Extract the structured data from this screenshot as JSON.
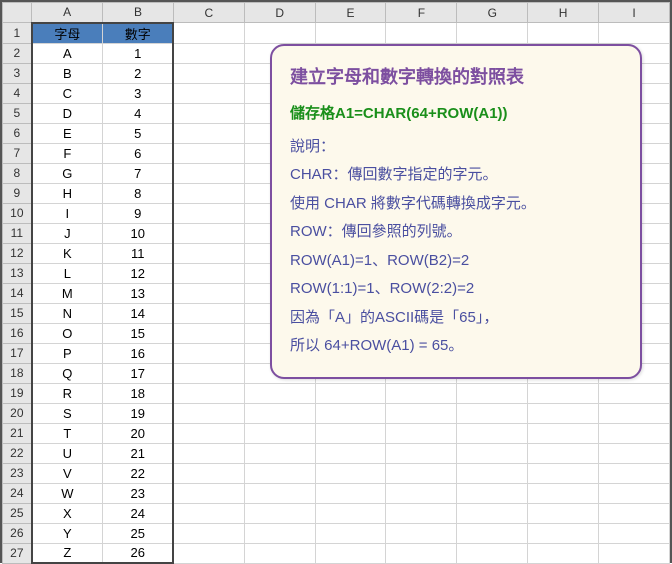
{
  "columns": [
    "A",
    "B",
    "C",
    "D",
    "E",
    "F",
    "G",
    "H",
    "I"
  ],
  "headers": {
    "A": "字母",
    "B": "數字"
  },
  "rows": [
    {
      "A": "A",
      "B": "1"
    },
    {
      "A": "B",
      "B": "2"
    },
    {
      "A": "C",
      "B": "3"
    },
    {
      "A": "D",
      "B": "4"
    },
    {
      "A": "E",
      "B": "5"
    },
    {
      "A": "F",
      "B": "6"
    },
    {
      "A": "G",
      "B": "7"
    },
    {
      "A": "H",
      "B": "8"
    },
    {
      "A": "I",
      "B": "9"
    },
    {
      "A": "J",
      "B": "10"
    },
    {
      "A": "K",
      "B": "11"
    },
    {
      "A": "L",
      "B": "12"
    },
    {
      "A": "M",
      "B": "13"
    },
    {
      "A": "N",
      "B": "14"
    },
    {
      "A": "O",
      "B": "15"
    },
    {
      "A": "P",
      "B": "16"
    },
    {
      "A": "Q",
      "B": "17"
    },
    {
      "A": "R",
      "B": "18"
    },
    {
      "A": "S",
      "B": "19"
    },
    {
      "A": "T",
      "B": "20"
    },
    {
      "A": "U",
      "B": "21"
    },
    {
      "A": "V",
      "B": "22"
    },
    {
      "A": "W",
      "B": "23"
    },
    {
      "A": "X",
      "B": "24"
    },
    {
      "A": "Y",
      "B": "25"
    },
    {
      "A": "Z",
      "B": "26"
    }
  ],
  "callout": {
    "title": "建立字母和數字轉換的對照表",
    "formula": "儲存格A1=CHAR(64+ROW(A1))",
    "lines": [
      "說明：",
      "CHAR：傳回數字指定的字元。",
      "使用 CHAR 將數字代碼轉換成字元。",
      "ROW：傳回參照的列號。",
      "ROW(A1)=1、ROW(B2)=2",
      "ROW(1:1)=1、ROW(2:2)=2",
      "因為「A」的ASCII碼是「65」，",
      "所以 64+ROW(A1) = 65。"
    ]
  }
}
